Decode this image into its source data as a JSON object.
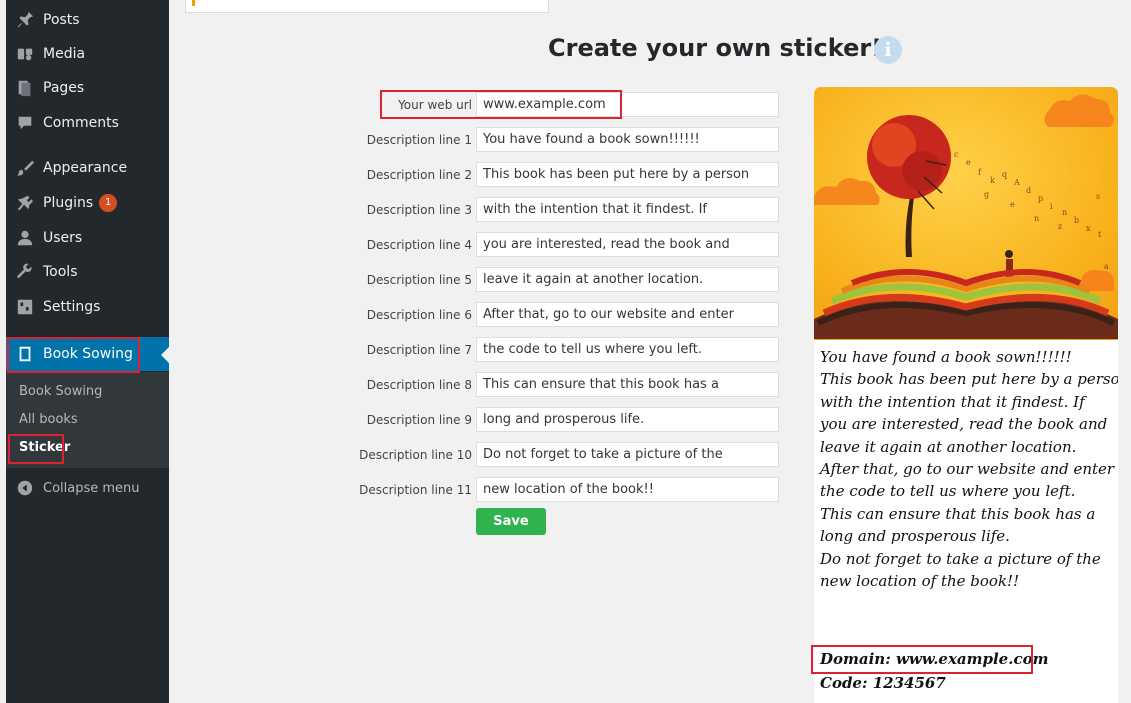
{
  "sidebar": {
    "items": [
      {
        "label": "Posts",
        "icon": "pin-icon"
      },
      {
        "label": "Media",
        "icon": "media-icon"
      },
      {
        "label": "Pages",
        "icon": "pages-icon"
      },
      {
        "label": "Comments",
        "icon": "comment-icon"
      },
      {
        "label": "Appearance",
        "icon": "brush-icon"
      },
      {
        "label": "Plugins",
        "icon": "plugin-icon",
        "badge": "1"
      },
      {
        "label": "Users",
        "icon": "users-icon"
      },
      {
        "label": "Tools",
        "icon": "wrench-icon"
      },
      {
        "label": "Settings",
        "icon": "settings-icon"
      },
      {
        "label": "Book Sowing",
        "icon": "book-icon"
      }
    ],
    "submenu": [
      "Book Sowing",
      "All books",
      "Sticker"
    ],
    "collapse_label": "Collapse menu"
  },
  "main": {
    "title": "Create your own sticker!!",
    "info_glyph": "i",
    "url_label": "Your web url",
    "url_value": "www.example.com",
    "lines": [
      {
        "label": "Description line 1",
        "value": "You have found a book sown!!!!!!"
      },
      {
        "label": "Description line 2",
        "value": "This book has been put here by a person"
      },
      {
        "label": "Description line 3",
        "value": "with the intention that it findest. If"
      },
      {
        "label": "Description line 4",
        "value": "you are interested, read the book and"
      },
      {
        "label": "Description line 5",
        "value": "leave it again at another location."
      },
      {
        "label": "Description line 6",
        "value": "After that, go to our website and enter"
      },
      {
        "label": "Description line 7",
        "value": "the code to tell us where you left."
      },
      {
        "label": "Description line 8",
        "value": "This can ensure that this book has a"
      },
      {
        "label": "Description line 9",
        "value": "long and prosperous life."
      },
      {
        "label": "Description line 10",
        "value": "Do not forget to take a picture of the"
      },
      {
        "label": "Description line 11",
        "value": "new location of the book!!"
      }
    ],
    "save_label": "Save"
  },
  "sticker": {
    "lines": [
      "You have found a book sown!!!!!!",
      "This book has been put here by a person",
      "with the intention that it findest. If",
      "you are interested, read the book and",
      "leave it again at another location.",
      "After that, go to our website and enter",
      "the code to tell us where you left.",
      "This can ensure that this book has a",
      "long and prosperous life.",
      "Do not forget to take a picture of the",
      "new location of the book!!"
    ],
    "domain": "Domain: www.example.com",
    "code": "Code: 1234567"
  },
  "colors": {
    "sidebar": "#23282d",
    "active": "#0073aa",
    "save": "#2fb34e",
    "highlight": "#dd2233",
    "badge": "#d54e21"
  }
}
